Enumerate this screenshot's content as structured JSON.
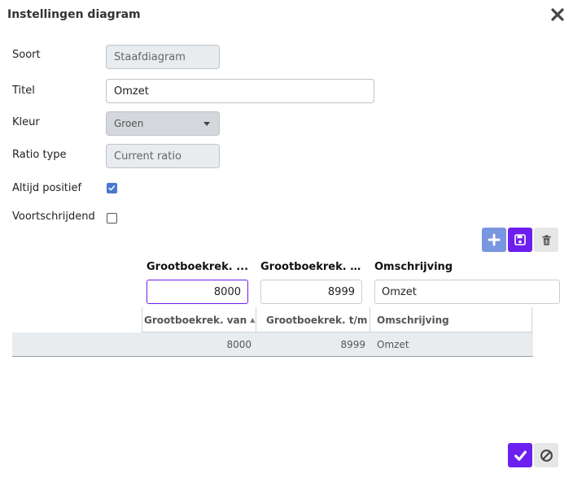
{
  "dialog": {
    "title": "Instellingen diagram"
  },
  "form": {
    "soort_label": "Soort",
    "soort_value": "Staafdiagram",
    "titel_label": "Titel",
    "titel_value": "Omzet",
    "kleur_label": "Kleur",
    "kleur_value": "Groen",
    "ratio_label": "Ratio type",
    "ratio_value": "Current ratio",
    "positief_label": "Altijd positief",
    "positief_checked": true,
    "voortschrijdend_label": "Voortschrijdend",
    "voortschrijdend_checked": false
  },
  "editor": {
    "col1_header": "Grootboekrek. ...",
    "col2_header": "Grootboekrek. t...",
    "col3_header": "Omschrijving",
    "col1_value": "8000",
    "col2_value": "8999",
    "col3_value": "Omzet"
  },
  "grid": {
    "headers": [
      "Grootboekrek. van",
      "Grootboekrek. t/m",
      "Omschrijving"
    ],
    "rows": [
      [
        "8000",
        "8999",
        "Omzet"
      ]
    ]
  },
  "icons": {
    "close": "close-icon",
    "add": "plus-icon",
    "save": "floppy-disk-icon",
    "delete": "trash-icon",
    "ok": "checkmark-icon",
    "cancel": "ban-icon"
  },
  "colors": {
    "accent": "#6c1fee",
    "add_button": "#7996e0",
    "checkbox": "#4a78d0"
  }
}
